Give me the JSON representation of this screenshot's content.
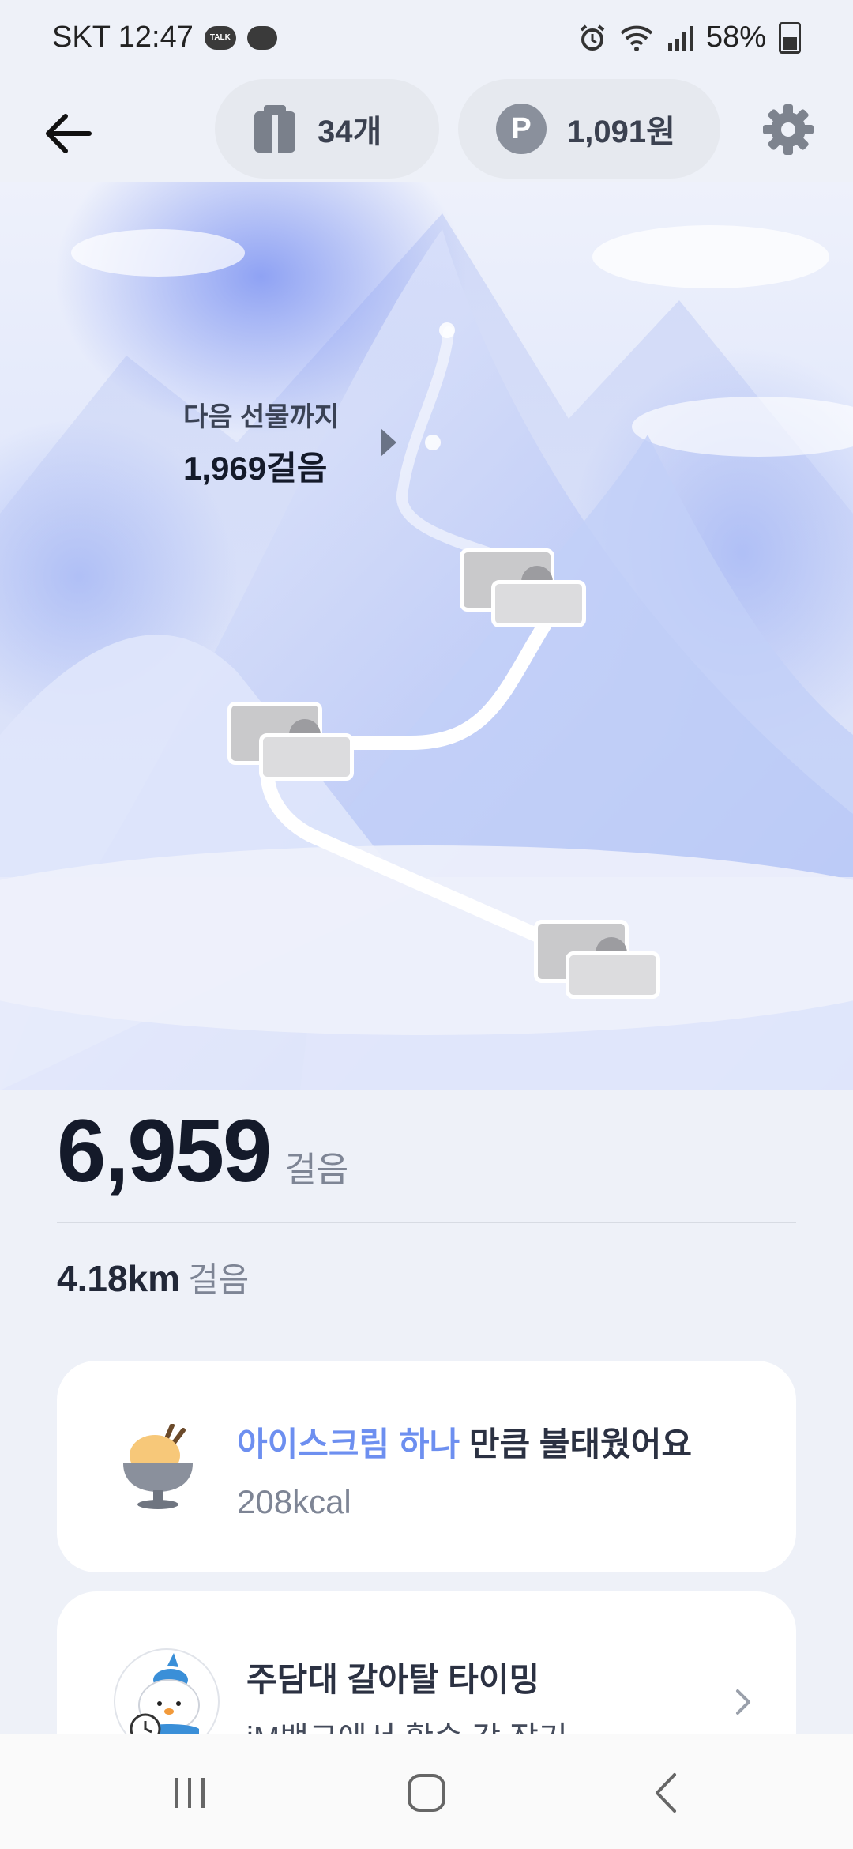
{
  "status_bar": {
    "carrier_time": "SKT 12:47",
    "talk_badge": "TALK",
    "battery": "58%",
    "icons": [
      "kakaotalk-icon",
      "chat-icon",
      "alarm-icon",
      "wifi-icon",
      "signal-icon",
      "battery-icon"
    ]
  },
  "header": {
    "gift_count": "34개",
    "points_symbol": "P",
    "points": "1,091원",
    "icons": [
      "back-arrow-icon",
      "gift-box-icon",
      "point-icon",
      "gear-icon"
    ]
  },
  "hero": {
    "next_gift_label": "다음 선물까지",
    "next_gift_steps": "1,969걸음"
  },
  "stats": {
    "steps": "6,959",
    "steps_unit": "걸음",
    "distance": "4.18km",
    "distance_unit": "걸음"
  },
  "calorie_card": {
    "accent_text": "아이스크림 하나",
    "rest_text": " 만큼 불태웠어요",
    "kcal": "208kcal"
  },
  "promo_card": {
    "title": "주담대 갈아탈 타이밍",
    "subtitle": "iM뱅크에서 확승 각 잡기"
  },
  "colors": {
    "accent": "#6d8ff0",
    "background": "#eef1f8",
    "card": "#ffffff"
  }
}
